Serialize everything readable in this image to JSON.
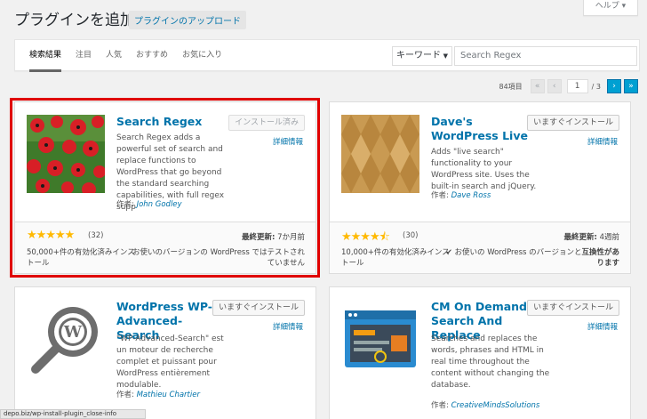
{
  "header": {
    "title": "プラグインを追加",
    "upload_label": "プラグインのアップロード",
    "help_label": "ヘルプ ▾"
  },
  "filter": {
    "tabs": [
      "検索結果",
      "注目",
      "人気",
      "おすすめ",
      "お気に入り"
    ],
    "active_tab": "検索結果",
    "search_type": "キーワード",
    "search_value": "Search Regex"
  },
  "pagination": {
    "count": "84項目",
    "first": "«",
    "prev": "‹",
    "current_page": "1",
    "of_label": "/ 3",
    "next": "›",
    "last": "»"
  },
  "plugins": [
    {
      "name": "Search Regex",
      "install_label": "インストール済み",
      "details_label": "詳細情報",
      "description": "Search Regex adds a powerful set of search and replace functions to WordPress that go beyond the standard searching capabilities, with full regex supp",
      "author_prefix": "作者: ",
      "author": "John Godley",
      "stars": "★★★★★",
      "rating_value": 5,
      "rating_count": "(32)",
      "updated_label": "最終更新:",
      "updated_value": "7か月前",
      "installs": "50,000+件の有効化済みインストール",
      "compat_text": "お使いのバージョンの WordPress ではテストされていません"
    },
    {
      "name": "Dave's WordPress Live Search",
      "install_label": "いますぐインストール",
      "details_label": "詳細情報",
      "description": "Adds \"live search\" functionality to your WordPress site. Uses the built-in search and jQuery.",
      "author_prefix": "作者: ",
      "author": "Dave Ross",
      "stars": "★★★★⯪",
      "rating_value": 4.5,
      "rating_count": "(30)",
      "updated_label": "最終更新:",
      "updated_value": "4週前",
      "installs": "10,000+件の有効化済みインストール",
      "compat_prefix": "✔ お使いの WordPress のバージョンと",
      "compat_bold": "互換性があります"
    },
    {
      "name": "WordPress WP-Advanced-Search",
      "install_label": "いますぐインストール",
      "details_label": "詳細情報",
      "description": "\"WP-Advanced-Search\" est un moteur de recherche complet et puissant pour WordPress entièrement modulable.",
      "author_prefix": "作者: ",
      "author": "Mathieu Chartier"
    },
    {
      "name": "CM On Demand Search And Replace",
      "install_label": "いますぐインストール",
      "details_label": "詳細情報",
      "description": "Searches and replaces the words, phrases and HTML in real time throughout the content without changing the database.",
      "author_prefix": "作者: ",
      "author": "CreativeMindsSolutions"
    }
  ],
  "status_bar": {
    "text": "depo.biz/wp-install-plugin_close-info"
  },
  "colors": {
    "accent": "#0073aa",
    "star": "#ffb900",
    "highlight": "#e00000"
  }
}
